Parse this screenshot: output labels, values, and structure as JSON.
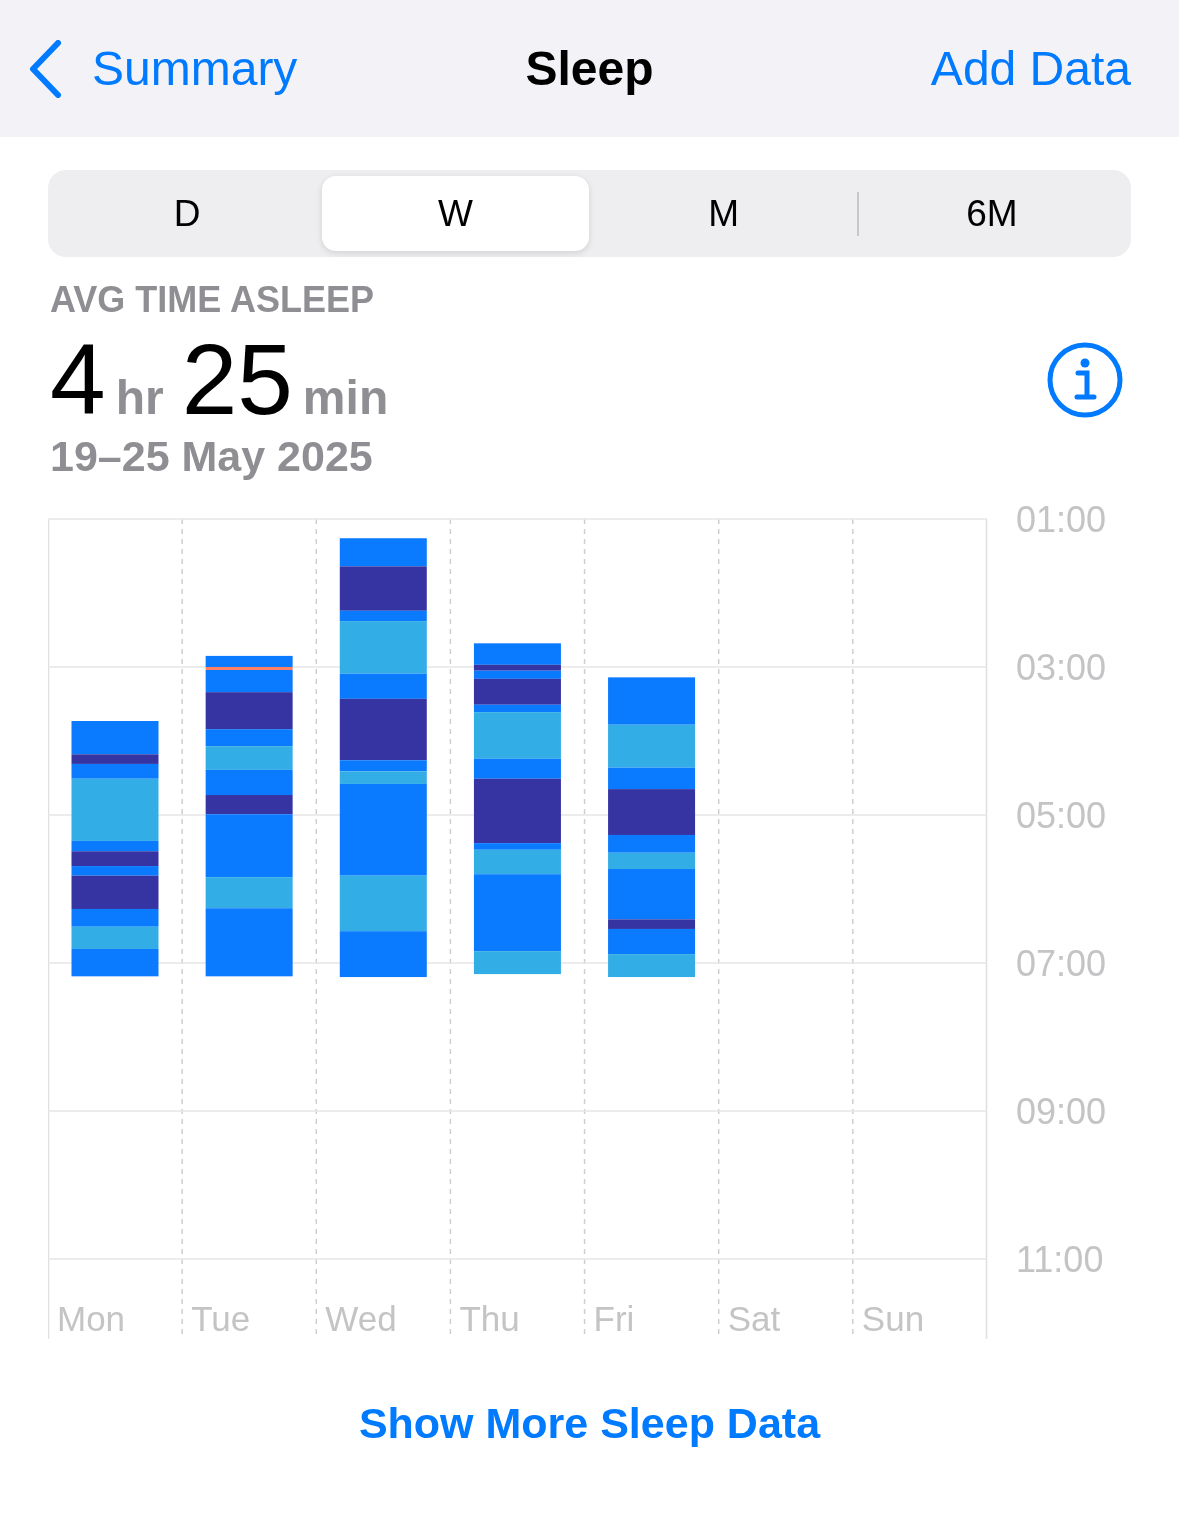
{
  "nav": {
    "back_label": "Summary",
    "title": "Sleep",
    "action": "Add Data"
  },
  "segments": [
    {
      "label": "D",
      "selected": false
    },
    {
      "label": "W",
      "selected": true
    },
    {
      "label": "M",
      "selected": false
    },
    {
      "label": "6M",
      "selected": false
    }
  ],
  "summary": {
    "heading": "AVG TIME ASLEEP",
    "hours": "4",
    "hours_unit": "hr",
    "minutes": "25",
    "minutes_unit": "min",
    "date_range": "19–25 May 2025"
  },
  "chart": {
    "y_labels": [
      "01:00",
      "03:00",
      "05:00",
      "07:00",
      "09:00",
      "11:00"
    ],
    "days": [
      "Mon",
      "Tue",
      "Wed",
      "Thu",
      "Fri",
      "Sat",
      "Sun"
    ]
  },
  "more_link": "Show More Sleep Data"
}
